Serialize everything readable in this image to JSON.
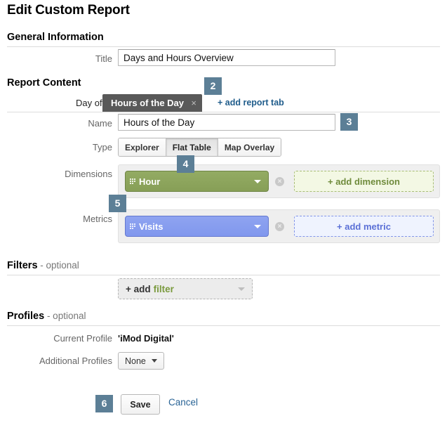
{
  "page": {
    "title": "Edit Custom Report"
  },
  "general": {
    "heading": "General Information",
    "title_label": "Title",
    "title_value": "Days and Hours Overview",
    "title_placeholder": ""
  },
  "report_content": {
    "heading": "Report Content",
    "tabs": [
      {
        "label": "Day of the Week",
        "active": false
      },
      {
        "label": "Hours of the Day",
        "active": true,
        "close_icon": "×"
      }
    ],
    "add_tab_label": "+ add report tab",
    "name_label": "Name",
    "name_value": "Hours of the Day",
    "type_label": "Type",
    "type_options": [
      {
        "label": "Explorer",
        "selected": false
      },
      {
        "label": "Flat Table",
        "selected": true
      },
      {
        "label": "Map Overlay",
        "selected": false
      }
    ],
    "dimensions_label": "Dimensions",
    "dimension_pill": "Hour",
    "add_dimension_label": "+ add dimension",
    "metrics_label": "Metrics",
    "metric_pill": "Visits",
    "add_metric_label": "+ add metric",
    "remove_icon": "×"
  },
  "filters": {
    "heading": "Filters",
    "optional": " - optional",
    "add_filter_plus": "+ add",
    "add_filter_word": "filter"
  },
  "profiles": {
    "heading": "Profiles",
    "optional": " - optional",
    "current_label": "Current Profile",
    "current_value": "'iMod Digital'",
    "additional_label": "Additional Profiles",
    "additional_value": "None"
  },
  "footer": {
    "save_label": "Save",
    "cancel_label": "Cancel"
  },
  "badges": {
    "two": "2",
    "three": "3",
    "four": "4",
    "five": "5",
    "six": "6"
  },
  "colors": {
    "badge": "#5c7f96",
    "active_tab": "#595959",
    "dimension_pill": "#879f57",
    "metric_pill": "#8097ee",
    "link": "#1f5c8b"
  }
}
